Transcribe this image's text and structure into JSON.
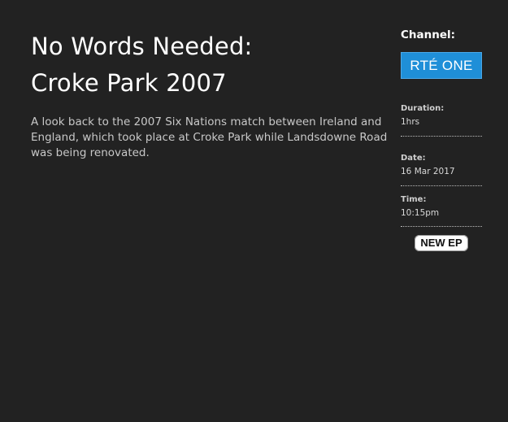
{
  "programme": {
    "title_line1": "No Words Needed:",
    "title_line2": "Croke Park 2007",
    "description": "A look back to the 2007 Six Nations match between Ireland and England, which took place at Croke Park while Landsdowne Road was being renovated."
  },
  "sidebar": {
    "channel_label": "Channel:",
    "channel_logo_text": "RTÉ ONE",
    "duration_label": "Duration:",
    "duration_value": "1hrs",
    "date_label": "Date:",
    "date_value": "16 Mar 2017",
    "time_label": "Time:",
    "time_value": "10:15pm",
    "badge": "NEW EP"
  },
  "colors": {
    "background": "#222222",
    "channel_logo_bg": "#1f8fd8"
  }
}
